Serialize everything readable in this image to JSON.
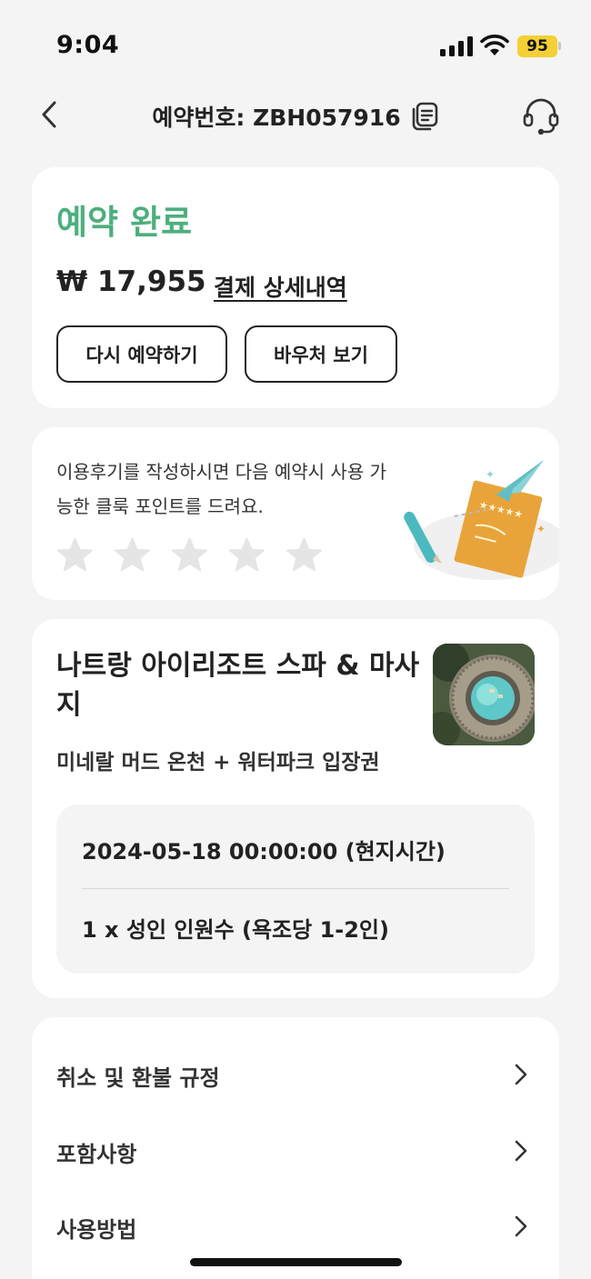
{
  "status_bar": {
    "time": "9:04",
    "battery": "95"
  },
  "header": {
    "title": "예약번호: ZBH057916"
  },
  "booking": {
    "status": "예약 완료",
    "price": "₩ 17,955",
    "price_detail_link": "결제 상세내역",
    "rebook_label": "다시 예약하기",
    "voucher_label": "바우처 보기"
  },
  "review": {
    "text": "이용후기를 작성하시면 다음 예약시 사용 가능한 클룩 포인트를 드려요.",
    "star_count": 5
  },
  "product": {
    "name": "나트랑 아이리조트 스파 & 마사지",
    "option": "미네랄 머드 온천 + 워터파크 입장권",
    "date": "2024-05-18 00:00:00 (현지시간)",
    "quantity": "1 x 성인 인원수 (욕조당 1-2인)"
  },
  "menu": {
    "items": [
      {
        "label": "취소 및 환불 규정"
      },
      {
        "label": "포함사항"
      },
      {
        "label": "사용방법"
      }
    ]
  },
  "colors": {
    "accent_green": "#4caf7c",
    "battery": "#f4d035",
    "background": "#f4f4f4"
  },
  "icons": [
    "back-arrow-icon",
    "copy-icon",
    "headset-icon",
    "star-icon",
    "chevron-right-icon"
  ]
}
